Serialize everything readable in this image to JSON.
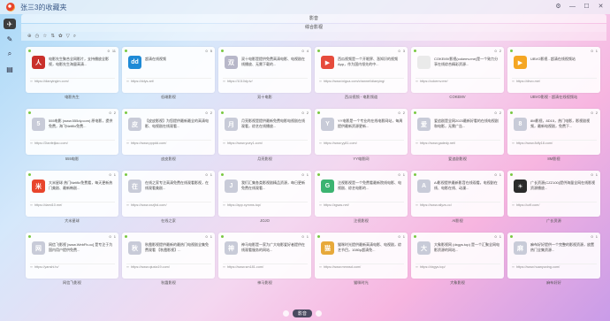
{
  "window": {
    "title": "张三3的收藏夹",
    "controls": [
      "⚙",
      "—",
      "☐",
      "✕"
    ]
  },
  "sidebar": {
    "items": [
      {
        "icon": "leaf-icon",
        "glyph": "✈",
        "active": true
      },
      {
        "icon": "pin-icon",
        "glyph": "✎",
        "active": false
      },
      {
        "icon": "search-icon",
        "glyph": "⌕",
        "active": false
      },
      {
        "icon": "book-icon",
        "glyph": "▤",
        "active": false
      }
    ]
  },
  "header": {
    "top_tab": "影音",
    "sub_tab": "综合影视"
  },
  "toolbar": {
    "icons": [
      "⊕",
      "◷",
      "☆",
      "⇅",
      "✿",
      "▽",
      "⌕"
    ]
  },
  "bottom": {
    "active_label": "影音"
  },
  "cards": [
    {
      "name": "电影先生",
      "desc": "电影先生聚合全网影片，支持播放全影视，电影先生海量高清...",
      "url": "https://dianyingim.com/",
      "stats": [
        "0",
        "11"
      ],
      "color": "#c9302c",
      "glyph": "人"
    },
    {
      "name": "低端影视",
      "desc": "超清在线视频",
      "url": "https://ddys.art/",
      "stats": [
        "0",
        "5"
      ],
      "color": "#1e8ad6",
      "glyph": "dd"
    },
    {
      "name": "双十电影",
      "desc": "双十电影是提供免费高清电影、电视剧在线播放、无需下载的...",
      "url": "https://1010dy.tv/",
      "stats": [
        "0",
        "4"
      ],
      "color": "#b7b7c9",
      "glyph": "双"
    },
    {
      "name": "西瓜视频 - 电影频道",
      "desc": "西瓜视频是一个开眼界、涨知识的视频 App，作为国内领先的中...",
      "url": "https://www.ixigua.com/channel/dianying/",
      "stats": [
        "0",
        "3"
      ],
      "color": "#e64b3c",
      "glyph": "▶"
    },
    {
      "name": "COKEMV",
      "desc": "COKEMV影视(cokemv.me)是一个致力分享在线综合精彩资源...",
      "url": "https://cokemv.me/",
      "stats": [
        "0",
        "2"
      ],
      "color": "#eaeaea",
      "glyph": " "
    },
    {
      "name": "UBVO影视 - 超清在线视频站",
      "desc": "UBVO影视 - 超清在线视频站",
      "url": "https://dbvo.me/",
      "stats": [
        "0",
        "1"
      ],
      "color": "#f5a623",
      "glyph": "▶"
    },
    {
      "name": "555电影",
      "desc": "555电影 (www.555dy.com) 原电影，提供免费，海飞Netflix免费...",
      "url": "https://2ianfeijiao.com/",
      "stats": [
        "0",
        "2"
      ],
      "color": "#c8cbd8",
      "glyph": "5"
    },
    {
      "name": "皮皮影视",
      "desc": "【皮皮影视】为您提供最新最全的高清电影、电视剧在线观看...",
      "url": "https://www.pppdd.com/",
      "stats": [
        "0",
        "2"
      ],
      "color": "#c8cbd8",
      "glyph": "皮"
    },
    {
      "name": "月亮影视",
      "desc": "月亮影视是提供最新免费电影电视剧在线观看，综艺在线播放...",
      "url": "https://www.yuey1.com/",
      "stats": [
        "0",
        "2"
      ],
      "color": "#c8cbd8",
      "glyph": "月"
    },
    {
      "name": "YY电影网",
      "desc": "YY电影是一个专业的在线电影网站，每周提供最新资源更新...",
      "url": "https://www.yy81.com/",
      "stats": [
        "0",
        "2"
      ],
      "color": "#c8cbd8",
      "glyph": "Y"
    },
    {
      "name": "爱追剧影视",
      "desc": "爱追剧是全网2023最新好看的在线电视剧和电影，无需广告...",
      "url": "https://www.gadedy.net/",
      "stats": [
        "0",
        "2"
      ],
      "color": "#c8cbd8",
      "glyph": "爱"
    },
    {
      "name": "8M影视",
      "desc": "8M影视，8D15，热门电影，影视剧视频，最新电视剧，免费下...",
      "url": "https://www.8dfy18.com/",
      "stats": [
        "0",
        "2"
      ],
      "color": "#c8cbd8",
      "glyph": "8"
    },
    {
      "name": "大米星球",
      "desc": "大米星球 热门Netflix免费看，每天更新热门美剧、最新韩剧...",
      "url": "https://dami10.me/",
      "stats": [
        "0",
        "1"
      ],
      "color": "#e8452c",
      "glyph": "米"
    },
    {
      "name": "在线之家",
      "desc": "在线之家专注高清免费在线观看影视，在线观看美剧...",
      "url": "https://www.zxzjhd.com/",
      "stats": [
        "0",
        "1"
      ],
      "color": "#c8cbd8",
      "glyph": "在"
    },
    {
      "name": "JOJO",
      "desc": "我们汇集各类影视剧精品资源，每日更新免费在线观看...",
      "url": "https://app.xymms.top/",
      "stats": [
        "0",
        "1"
      ],
      "color": "#c8cbd8",
      "glyph": "J"
    },
    {
      "name": "注视影视",
      "desc": "注视影视是一个免费看最新院线电影、电视剧、综艺电影的...",
      "url": "https://zgsas.net/",
      "stats": [
        "0",
        "1"
      ],
      "color": "#3cb371",
      "glyph": "G"
    },
    {
      "name": "AI影视",
      "desc": "AI影视提供最新影音在线观看，电视剧在线、电影在线、动漫...",
      "url": "https://www.ailyzs.cc/",
      "stats": [
        "0",
        "1"
      ],
      "color": "#c8cbd8",
      "glyph": "A"
    },
    {
      "name": "广长资源",
      "desc": "广长资源(CZZ100)提供海量全网在线影视资源播放...",
      "url": "https://czlf.com/",
      "stats": [
        "0",
        "1"
      ],
      "color": "#2a2a2a",
      "glyph": "☀"
    },
    {
      "name": "网信飞影视",
      "desc": "网信飞影视 [www.WebFlv.cc] 是专注于为国内用户提供免费...",
      "url": "https://yanshi.tv/",
      "stats": [
        "0",
        "1"
      ],
      "color": "#c8cbd8",
      "glyph": "网"
    },
    {
      "name": "秋霞影视",
      "desc": "秋霞影视提供最新的最热门电视剧全集免费观看 【秋霞影视】...",
      "url": "https://www.qiuxia19.com/",
      "stats": [
        "0",
        "1"
      ],
      "color": "#c8cbd8",
      "glyph": "秋"
    },
    {
      "name": "神马影视",
      "desc": "神马电影是一家为广大电影爱好者提供在线观看服务的网站...",
      "url": "https://www.sm181.com/",
      "stats": [
        "0",
        "1"
      ],
      "color": "#c8cbd8",
      "glyph": "神"
    },
    {
      "name": "猫咪时光",
      "desc": "猫咪时光提供最新高清电影、电视剧，综艺节目，1080p超清免...",
      "url": "https://www.mmnsd.com/",
      "stats": [
        "0",
        "1"
      ],
      "color": "#e7a93a",
      "glyph": "猫"
    },
    {
      "name": "大象影视",
      "desc": "大象影视网 (dxgys.top) 是一个汇聚全网电影资源的网站...",
      "url": "https://dxgys.top/",
      "stats": [
        "0",
        "1"
      ],
      "color": "#c8cbd8",
      "glyph": "大"
    },
    {
      "name": "麻布好好",
      "desc": "麻布好好提供一个完整的影视资源，放置热门全集资源...",
      "url": "https://www.huanyuxing.com/",
      "stats": [
        "0",
        "1"
      ],
      "color": "#c8cbd8",
      "glyph": "麻"
    }
  ]
}
